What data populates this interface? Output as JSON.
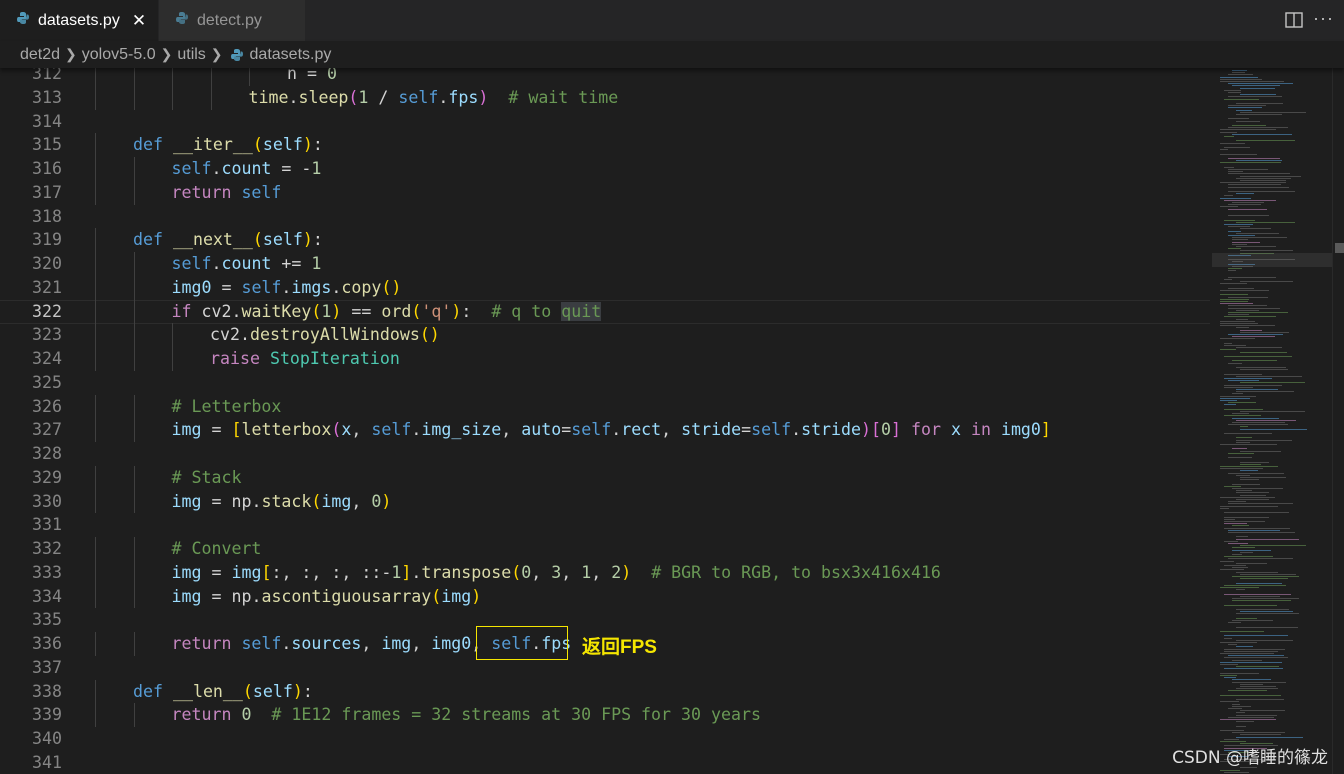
{
  "tabs": [
    {
      "label": "datasets.py",
      "active": true,
      "close_glyph": "✕"
    },
    {
      "label": "detect.py",
      "active": false
    }
  ],
  "toolbar": {
    "more_glyph": "···"
  },
  "breadcrumb": [
    "det2d",
    "yolov5-5.0",
    "utils",
    "datasets.py"
  ],
  "annotation": {
    "label": "返回FPS"
  },
  "watermark": "CSDN @嗜睡的篠龙",
  "colors": {
    "background": "#1e1e1e",
    "tab_bar": "#252526",
    "annotation": "#f5e600",
    "keyword": "#569cd6",
    "control": "#c586c0",
    "function": "#dcdcaa",
    "comment": "#6a9955",
    "number": "#b5cea8",
    "string": "#ce9178",
    "class": "#4ec9b0"
  },
  "editor": {
    "current_line": 322,
    "lines": [
      {
        "n": 312,
        "indent": 5,
        "tokens": [
          [
            "plain",
            "n = "
          ],
          [
            "num",
            "0"
          ]
        ]
      },
      {
        "n": 313,
        "indent": 4,
        "tokens": [
          [
            "fn",
            "time"
          ],
          [
            "plain",
            "."
          ],
          [
            "fn",
            "sleep"
          ],
          [
            "p2",
            "("
          ],
          [
            "num",
            "1"
          ],
          [
            "plain",
            " / "
          ],
          [
            "self",
            "self"
          ],
          [
            "plain",
            "."
          ],
          [
            "var",
            "fps"
          ],
          [
            "p2",
            ")"
          ],
          [
            "plain",
            "  "
          ],
          [
            "cm",
            "# wait time"
          ]
        ]
      },
      {
        "n": 314,
        "indent": 0,
        "tokens": []
      },
      {
        "n": 315,
        "indent": 1,
        "tokens": [
          [
            "kw",
            "def "
          ],
          [
            "fn",
            "__iter__"
          ],
          [
            "p1",
            "("
          ],
          [
            "var",
            "self"
          ],
          [
            "p1",
            ")"
          ],
          [
            "plain",
            ":"
          ]
        ]
      },
      {
        "n": 316,
        "indent": 2,
        "tokens": [
          [
            "self",
            "self"
          ],
          [
            "plain",
            "."
          ],
          [
            "var",
            "count"
          ],
          [
            "plain",
            " = -"
          ],
          [
            "num",
            "1"
          ]
        ]
      },
      {
        "n": 317,
        "indent": 2,
        "tokens": [
          [
            "ctl",
            "return "
          ],
          [
            "self",
            "self"
          ]
        ]
      },
      {
        "n": 318,
        "indent": 0,
        "tokens": []
      },
      {
        "n": 319,
        "indent": 1,
        "tokens": [
          [
            "kw",
            "def "
          ],
          [
            "fn",
            "__next__"
          ],
          [
            "p1",
            "("
          ],
          [
            "var",
            "self"
          ],
          [
            "p1",
            ")"
          ],
          [
            "plain",
            ":"
          ]
        ]
      },
      {
        "n": 320,
        "indent": 2,
        "tokens": [
          [
            "self",
            "self"
          ],
          [
            "plain",
            "."
          ],
          [
            "var",
            "count"
          ],
          [
            "plain",
            " += "
          ],
          [
            "num",
            "1"
          ]
        ]
      },
      {
        "n": 321,
        "indent": 2,
        "tokens": [
          [
            "var",
            "img0"
          ],
          [
            "plain",
            " = "
          ],
          [
            "self",
            "self"
          ],
          [
            "plain",
            "."
          ],
          [
            "var",
            "imgs"
          ],
          [
            "plain",
            "."
          ],
          [
            "fn",
            "copy"
          ],
          [
            "p1",
            "()"
          ]
        ]
      },
      {
        "n": 322,
        "indent": 2,
        "tokens": [
          [
            "ctl",
            "if "
          ],
          [
            "plain",
            "cv2."
          ],
          [
            "fn",
            "waitKey"
          ],
          [
            "p1",
            "("
          ],
          [
            "num",
            "1"
          ],
          [
            "p1",
            ")"
          ],
          [
            "plain",
            " == "
          ],
          [
            "fn",
            "ord"
          ],
          [
            "p1",
            "("
          ],
          [
            "str",
            "'q'"
          ],
          [
            "p1",
            ")"
          ],
          [
            "plain",
            ":  "
          ],
          [
            "cm",
            "# q to "
          ],
          [
            "cmhl",
            "quit"
          ]
        ]
      },
      {
        "n": 323,
        "indent": 3,
        "tokens": [
          [
            "plain",
            "cv2."
          ],
          [
            "fn",
            "destroyAllWindows"
          ],
          [
            "p1",
            "()"
          ]
        ]
      },
      {
        "n": 324,
        "indent": 3,
        "tokens": [
          [
            "ctl",
            "raise "
          ],
          [
            "cls",
            "StopIteration"
          ]
        ]
      },
      {
        "n": 325,
        "indent": 0,
        "tokens": []
      },
      {
        "n": 326,
        "indent": 2,
        "tokens": [
          [
            "cm",
            "# Letterbox"
          ]
        ]
      },
      {
        "n": 327,
        "indent": 2,
        "tokens": [
          [
            "var",
            "img"
          ],
          [
            "plain",
            " = "
          ],
          [
            "p1",
            "["
          ],
          [
            "fn",
            "letterbox"
          ],
          [
            "p2",
            "("
          ],
          [
            "var",
            "x"
          ],
          [
            "plain",
            ", "
          ],
          [
            "self",
            "self"
          ],
          [
            "plain",
            "."
          ],
          [
            "var",
            "img_size"
          ],
          [
            "plain",
            ", "
          ],
          [
            "var",
            "auto"
          ],
          [
            "plain",
            "="
          ],
          [
            "self",
            "self"
          ],
          [
            "plain",
            "."
          ],
          [
            "var",
            "rect"
          ],
          [
            "plain",
            ", "
          ],
          [
            "var",
            "stride"
          ],
          [
            "plain",
            "="
          ],
          [
            "self",
            "self"
          ],
          [
            "plain",
            "."
          ],
          [
            "var",
            "stride"
          ],
          [
            "p2",
            ")"
          ],
          [
            "p2",
            "["
          ],
          [
            "num",
            "0"
          ],
          [
            "p2",
            "]"
          ],
          [
            "ctl",
            " for "
          ],
          [
            "var",
            "x"
          ],
          [
            "ctl",
            " in "
          ],
          [
            "var",
            "img0"
          ],
          [
            "p1",
            "]"
          ]
        ]
      },
      {
        "n": 328,
        "indent": 0,
        "tokens": []
      },
      {
        "n": 329,
        "indent": 2,
        "tokens": [
          [
            "cm",
            "# Stack"
          ]
        ]
      },
      {
        "n": 330,
        "indent": 2,
        "tokens": [
          [
            "var",
            "img"
          ],
          [
            "plain",
            " = "
          ],
          [
            "plain",
            "np."
          ],
          [
            "fn",
            "stack"
          ],
          [
            "p1",
            "("
          ],
          [
            "var",
            "img"
          ],
          [
            "plain",
            ", "
          ],
          [
            "num",
            "0"
          ],
          [
            "p1",
            ")"
          ]
        ]
      },
      {
        "n": 331,
        "indent": 0,
        "tokens": []
      },
      {
        "n": 332,
        "indent": 2,
        "tokens": [
          [
            "cm",
            "# Convert"
          ]
        ]
      },
      {
        "n": 333,
        "indent": 2,
        "tokens": [
          [
            "var",
            "img"
          ],
          [
            "plain",
            " = "
          ],
          [
            "var",
            "img"
          ],
          [
            "p1",
            "["
          ],
          [
            "plain",
            ":, :, :, ::-"
          ],
          [
            "num",
            "1"
          ],
          [
            "p1",
            "]"
          ],
          [
            "plain",
            "."
          ],
          [
            "fn",
            "transpose"
          ],
          [
            "p1",
            "("
          ],
          [
            "num",
            "0"
          ],
          [
            "plain",
            ", "
          ],
          [
            "num",
            "3"
          ],
          [
            "plain",
            ", "
          ],
          [
            "num",
            "1"
          ],
          [
            "plain",
            ", "
          ],
          [
            "num",
            "2"
          ],
          [
            "p1",
            ")"
          ],
          [
            "plain",
            "  "
          ],
          [
            "cm",
            "# BGR to RGB, to bsx3x416x416"
          ]
        ]
      },
      {
        "n": 334,
        "indent": 2,
        "tokens": [
          [
            "var",
            "img"
          ],
          [
            "plain",
            " = "
          ],
          [
            "plain",
            "np."
          ],
          [
            "fn",
            "ascontiguousarray"
          ],
          [
            "p1",
            "("
          ],
          [
            "var",
            "img"
          ],
          [
            "p1",
            ")"
          ]
        ]
      },
      {
        "n": 335,
        "indent": 0,
        "tokens": []
      },
      {
        "n": 336,
        "indent": 2,
        "tokens": [
          [
            "ctl",
            "return "
          ],
          [
            "self",
            "self"
          ],
          [
            "plain",
            "."
          ],
          [
            "var",
            "sources"
          ],
          [
            "plain",
            ", "
          ],
          [
            "var",
            "img"
          ],
          [
            "plain",
            ", "
          ],
          [
            "var",
            "img0"
          ],
          [
            "plain",
            ", "
          ],
          [
            "self",
            "self"
          ],
          [
            "plain",
            "."
          ],
          [
            "var",
            "fps"
          ]
        ]
      },
      {
        "n": 337,
        "indent": 0,
        "tokens": []
      },
      {
        "n": 338,
        "indent": 1,
        "tokens": [
          [
            "kw",
            "def "
          ],
          [
            "fn",
            "__len__"
          ],
          [
            "p1",
            "("
          ],
          [
            "var",
            "self"
          ],
          [
            "p1",
            ")"
          ],
          [
            "plain",
            ":"
          ]
        ]
      },
      {
        "n": 339,
        "indent": 2,
        "tokens": [
          [
            "ctl",
            "return "
          ],
          [
            "num",
            "0"
          ],
          [
            "plain",
            "  "
          ],
          [
            "cm",
            "# 1E12 frames = 32 streams at 30 FPS for 30 years"
          ]
        ]
      },
      {
        "n": 340,
        "indent": 0,
        "tokens": []
      },
      {
        "n": 341,
        "indent": 0,
        "tokens": []
      }
    ]
  }
}
